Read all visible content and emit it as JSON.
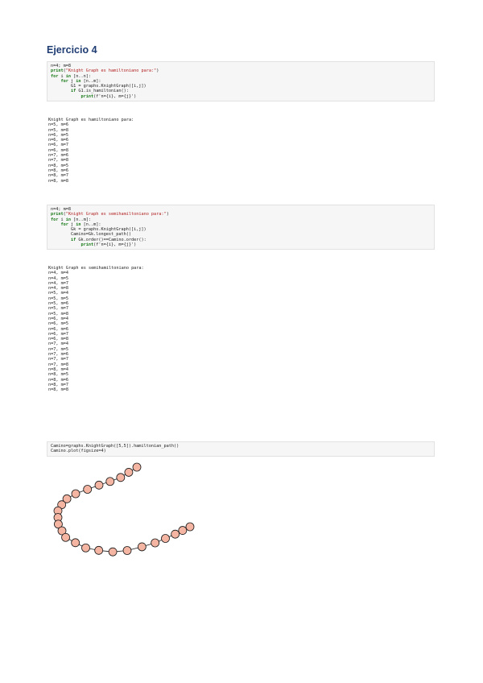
{
  "heading": "Ejercicio 4",
  "cells": [
    {
      "id": "cell-1",
      "code": [
        [
          {
            "t": "n=4; m=8",
            "c": "plain"
          }
        ],
        [
          {
            "t": "print",
            "c": "kw"
          },
          {
            "t": "(",
            "c": "plain"
          },
          {
            "t": "\"Knight Graph es hamiltoniano para:\"",
            "c": "str"
          },
          {
            "t": ")",
            "c": "plain"
          }
        ],
        [
          {
            "t": "for",
            "c": "kw"
          },
          {
            "t": " i ",
            "c": "plain"
          },
          {
            "t": "in",
            "c": "kw"
          },
          {
            "t": " [n..n]:",
            "c": "plain"
          }
        ],
        [
          {
            "t": "    ",
            "c": "plain"
          },
          {
            "t": "for",
            "c": "kw"
          },
          {
            "t": " j ",
            "c": "plain"
          },
          {
            "t": "in",
            "c": "kw"
          },
          {
            "t": " [n..m]:",
            "c": "plain"
          }
        ],
        [
          {
            "t": "        G1 = graphs.KnightGraph([i,j])",
            "c": "plain"
          }
        ],
        [
          {
            "t": "        ",
            "c": "plain"
          },
          {
            "t": "if",
            "c": "kw"
          },
          {
            "t": " G1.is_hamiltonian():",
            "c": "plain"
          }
        ],
        [
          {
            "t": "            ",
            "c": "plain"
          },
          {
            "t": "print",
            "c": "kw"
          },
          {
            "t": "(f'n={i}, m={j}')",
            "c": "plain"
          }
        ]
      ],
      "output": [
        "Knight Graph es hamiltoniano para:",
        "n=5, m=6",
        "n=5, m=8",
        "n=6, m=5",
        "n=6, m=6",
        "n=6, m=7",
        "n=6, m=8",
        "n=7, m=6",
        "n=7, m=8",
        "n=8, m=5",
        "n=8, m=6",
        "n=8, m=7",
        "n=8, m=8"
      ]
    },
    {
      "id": "cell-2",
      "code": [
        [
          {
            "t": "n=4; m=8",
            "c": "plain"
          }
        ],
        [
          {
            "t": "print",
            "c": "kw"
          },
          {
            "t": "(",
            "c": "plain"
          },
          {
            "t": "\"Knight Graph es semihamiltoniano para:\"",
            "c": "str"
          },
          {
            "t": ")",
            "c": "plain"
          }
        ],
        [
          {
            "t": "for",
            "c": "kw"
          },
          {
            "t": " i ",
            "c": "plain"
          },
          {
            "t": "in",
            "c": "kw"
          },
          {
            "t": " [n..m]:",
            "c": "plain"
          }
        ],
        [
          {
            "t": "    ",
            "c": "plain"
          },
          {
            "t": "for",
            "c": "kw"
          },
          {
            "t": " j ",
            "c": "plain"
          },
          {
            "t": "in",
            "c": "kw"
          },
          {
            "t": " [n..m]:",
            "c": "plain"
          }
        ],
        [
          {
            "t": "        Gk = graphs.KnightGraph([i,j])",
            "c": "plain"
          }
        ],
        [
          {
            "t": "        Camino=Gk.longest_path()",
            "c": "plain"
          }
        ],
        [
          {
            "t": "        ",
            "c": "plain"
          },
          {
            "t": "if",
            "c": "kw"
          },
          {
            "t": " Gk.order()==Camino.order():",
            "c": "plain"
          }
        ],
        [
          {
            "t": "            ",
            "c": "plain"
          },
          {
            "t": "print",
            "c": "kw"
          },
          {
            "t": "(f'n={i}, m={j}')",
            "c": "plain"
          }
        ]
      ],
      "output": [
        "Knight Graph es semihamiltoniano para:",
        "n=4, m=4",
        "n=4, m=5",
        "n=4, m=7",
        "n=4, m=8",
        "n=5, m=4",
        "n=5, m=5",
        "n=5, m=6",
        "n=5, m=7",
        "n=5, m=8",
        "n=6, m=4",
        "n=6, m=5",
        "n=6, m=6",
        "n=6, m=7",
        "n=6, m=8",
        "n=7, m=4",
        "n=7, m=5",
        "n=7, m=6",
        "n=7, m=7",
        "n=7, m=8",
        "n=8, m=4",
        "n=8, m=5",
        "n=8, m=6",
        "n=8, m=7",
        "n=8, m=8"
      ]
    },
    {
      "id": "cell-3",
      "code": [
        [
          {
            "t": "Camino=graphs.KnightGraph([5,5]).hamiltonian_path()",
            "c": "plain"
          }
        ],
        [
          {
            "t": "Camino.plot(figsize=4)",
            "c": "plain"
          }
        ]
      ],
      "output": []
    }
  ],
  "plot": {
    "node_count": 25,
    "node_fill": "#f4b5a3",
    "node_stroke": "#1a1a1a",
    "edge_color": "#1a1a1a"
  }
}
